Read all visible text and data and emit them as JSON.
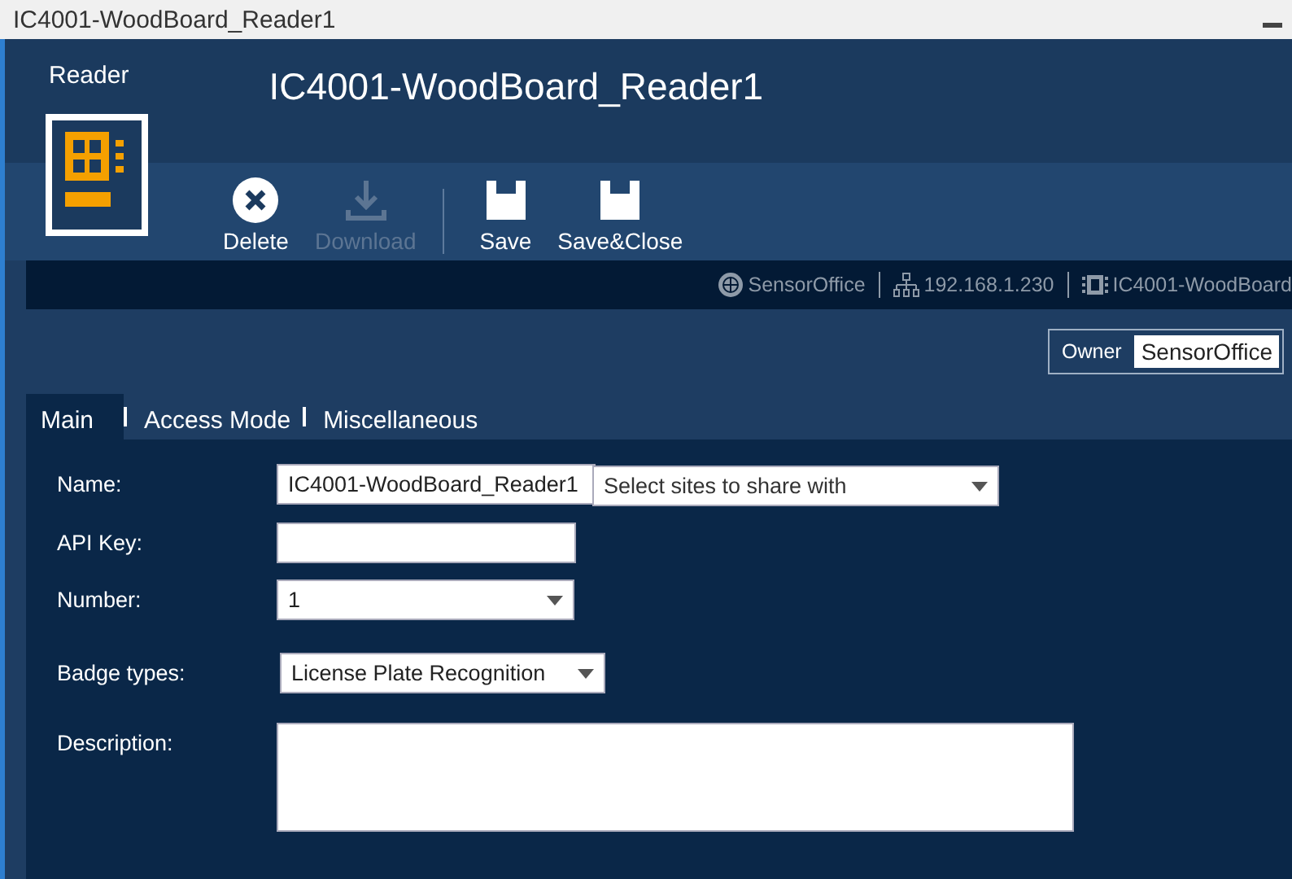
{
  "window": {
    "title": "IC4001-WoodBoard_Reader1"
  },
  "header": {
    "type_label": "Reader",
    "title": "IC4001-WoodBoard_Reader1"
  },
  "toolbar": {
    "groups": [
      [
        {
          "label": "Delete",
          "kind": "delete",
          "disabled": false
        },
        {
          "label": "Download",
          "kind": "download",
          "disabled": true
        }
      ],
      [
        {
          "label": "Save",
          "kind": "save",
          "disabled": false
        },
        {
          "label": "Save&Close",
          "kind": "save",
          "disabled": false
        }
      ]
    ]
  },
  "status_bar": [
    {
      "kind": "globe",
      "text": "SensorOffice"
    },
    {
      "kind": "network",
      "text": "192.168.1.230"
    },
    {
      "kind": "chip",
      "text": "IC4001-WoodBoard"
    }
  ],
  "owner": {
    "label": "Owner",
    "value": "SensorOffice"
  },
  "tabs": [
    {
      "label": "Main",
      "selected": true
    },
    {
      "label": "Access Mode",
      "selected": false
    },
    {
      "label": "Miscellaneous",
      "selected": false
    }
  ],
  "form": {
    "fields": [
      {
        "label": "Name:",
        "kind": "text",
        "value": "IC4001-WoodBoard_Reader1"
      },
      {
        "label": "API Key:",
        "kind": "text"
      },
      {
        "label": "Number:",
        "kind": "dropdown",
        "value": "1"
      },
      {
        "label": "Badge types:",
        "kind": "dropdown",
        "value": "License Plate Recognition"
      },
      {
        "label": "Description:",
        "kind": "textarea"
      }
    ],
    "share": {
      "placeholder": "Select sites to share with"
    }
  }
}
